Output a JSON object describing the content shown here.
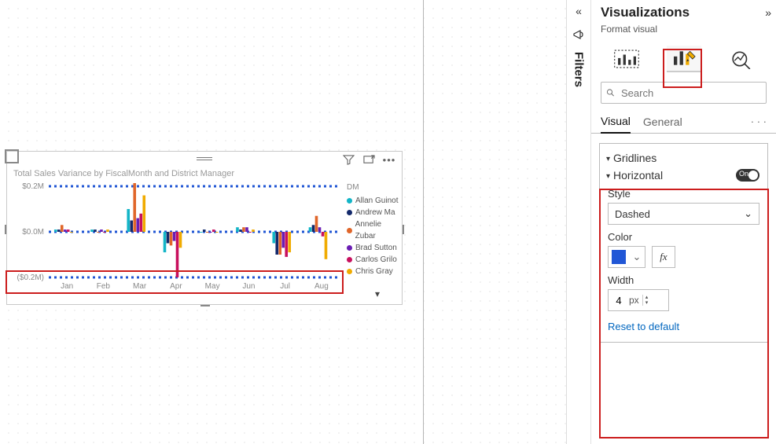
{
  "panel": {
    "title": "Visualizations",
    "subtitle": "Format visual",
    "search_placeholder": "Search",
    "tabs": {
      "visual": "Visual",
      "general": "General"
    }
  },
  "gridlines": {
    "title": "Gridlines",
    "horizontal_label": "Horizontal",
    "toggle_text": "On",
    "style_label": "Style",
    "style_value": "Dashed",
    "color_label": "Color",
    "color_hex": "#2157d6",
    "width_label": "Width",
    "width_value": "4",
    "width_unit": "px",
    "reset": "Reset to default"
  },
  "filters_label": "Filters",
  "chart": {
    "title": "Total Sales Variance by FiscalMonth and District Manager",
    "y_ticks": [
      "$0.2M",
      "$0.0M",
      "($0.2M)"
    ],
    "x_ticks": [
      "Jan",
      "Feb",
      "Mar",
      "Apr",
      "May",
      "Jun",
      "Jul",
      "Aug"
    ],
    "legend_title": "DM",
    "legend": [
      {
        "label": "Allan Guinot",
        "color": "#13b5c7"
      },
      {
        "label": "Andrew Ma",
        "color": "#13296b"
      },
      {
        "label": "Annelie Zubar",
        "color": "#e0662a"
      },
      {
        "label": "Brad Sutton",
        "color": "#6a1db3"
      },
      {
        "label": "Carlos Grilo",
        "color": "#c8105e"
      },
      {
        "label": "Chris Gray",
        "color": "#f0ab00"
      }
    ]
  },
  "chart_data": {
    "type": "bar",
    "title": "Total Sales Variance by FiscalMonth and District Manager",
    "xlabel": "",
    "ylabel": "",
    "ylim": [
      -0.2,
      0.2
    ],
    "y_unit": "$M",
    "categories": [
      "Jan",
      "Feb",
      "Mar",
      "Apr",
      "May",
      "Jun",
      "Jul",
      "Aug"
    ],
    "gridlines": {
      "axis": "y",
      "style": "Dashed",
      "color": "#2157d6",
      "width": 4
    },
    "series": [
      {
        "name": "Allan Guinot",
        "color": "#13b5c7",
        "values": [
          0.01,
          0.01,
          0.1,
          -0.09,
          0.0,
          0.02,
          -0.05,
          0.02
        ]
      },
      {
        "name": "Andrew Ma",
        "color": "#13296b",
        "values": [
          0.01,
          0.01,
          0.05,
          -0.05,
          0.01,
          0.01,
          -0.1,
          0.03
        ]
      },
      {
        "name": "Annelie Zubar",
        "color": "#e0662a",
        "values": [
          0.03,
          0.0,
          0.22,
          -0.06,
          0.0,
          0.02,
          -0.1,
          0.07
        ]
      },
      {
        "name": "Brad Sutton",
        "color": "#6a1db3",
        "values": [
          0.01,
          0.01,
          0.06,
          -0.04,
          0.0,
          0.02,
          -0.07,
          0.02
        ]
      },
      {
        "name": "Carlos Grilo",
        "color": "#c8105e",
        "values": [
          0.01,
          0.0,
          0.08,
          -0.2,
          0.01,
          0.0,
          -0.11,
          -0.02
        ]
      },
      {
        "name": "Chris Gray",
        "color": "#f0ab00",
        "values": [
          0.0,
          0.01,
          0.16,
          -0.07,
          0.0,
          0.01,
          -0.09,
          -0.12
        ]
      }
    ]
  }
}
